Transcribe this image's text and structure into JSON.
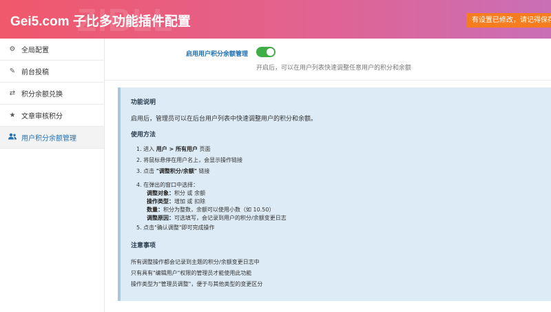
{
  "header": {
    "title": "Gei5.com 子比多功能插件配置",
    "watermark": "ZIBLL",
    "save_notice": "有设置已修改，请记得保存！"
  },
  "sidebar": {
    "items": [
      {
        "label": "全局配置",
        "icon": "gear-icon"
      },
      {
        "label": "前台投稿",
        "icon": "edit-icon"
      },
      {
        "label": "积分余额兑换",
        "icon": "exchange-icon"
      },
      {
        "label": "文章审核积分",
        "icon": "star-icon"
      },
      {
        "label": "用户积分余额管理",
        "icon": "users-icon"
      }
    ],
    "active_index": 4
  },
  "setting": {
    "label": "启用用户积分余额管理",
    "enabled": true,
    "description": "开启后，可以在用户列表快速调整任意用户的积分和余额"
  },
  "info": {
    "func_title": "功能说明",
    "func_text": "启用后，管理员可以在后台用户列表中快速调整用户的积分和余额。",
    "usage_title": "使用方法",
    "step1_pre": "1. 进入 ",
    "step1_bold": "用户 > 所有用户",
    "step1_post": " 页面",
    "step2": "2. 将鼠标悬停在用户名上，会显示操作链接",
    "step3_pre": "3. 点击 ",
    "step3_bold": "\"调整积分/余额\"",
    "step3_post": " 链接",
    "step4": "4. 在弹出的窗口中选择：",
    "sub1_label": "调整对象：",
    "sub1_text": "积分 或 余额",
    "sub2_label": "操作类型：",
    "sub2_text": "增加 或 扣除",
    "sub3_label": "数量：",
    "sub3_text": "积分为整数，余额可以使用小数（如 10.50）",
    "sub4_label": "调整原因：",
    "sub4_text": "可选填写，会记录到用户的积分/余额变更日志",
    "step5": "5. 点击\"确认调整\"即可完成操作",
    "notes_title": "注意事项",
    "note1": "所有调整操作都会记录到主题的积分/余额变更日志中",
    "note2": "只有具有\"编辑用户\"权限的管理员才能使用此功能",
    "note3": "操作类型为\"管理员调整\"，便于与其他类型的变更区分"
  },
  "colors": {
    "header_start": "#f0586b",
    "header_end": "#c96fb6",
    "accent": "#2271b1",
    "toggle_on": "#3fae48",
    "notice": "#f57c1f",
    "info_bg": "#dcebf5"
  }
}
